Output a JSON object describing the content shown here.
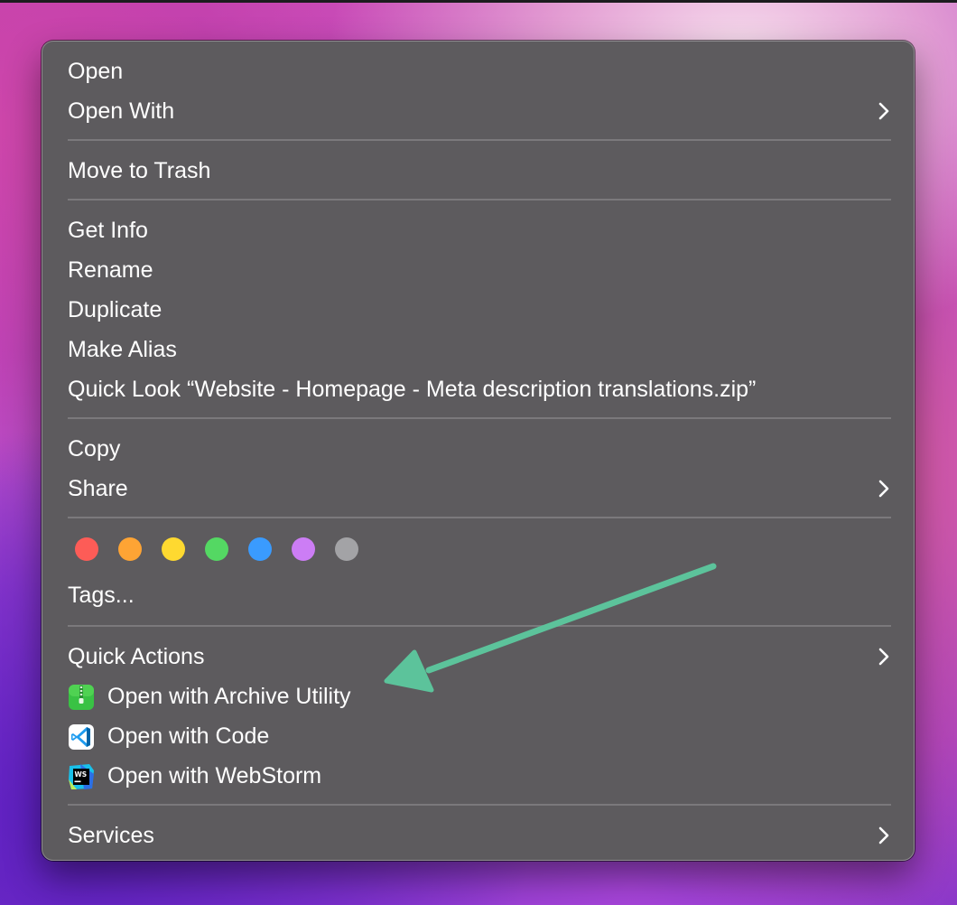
{
  "context_menu": {
    "open": "Open",
    "open_with": "Open With",
    "move_to_trash": "Move to Trash",
    "get_info": "Get Info",
    "rename": "Rename",
    "duplicate": "Duplicate",
    "make_alias": "Make Alias",
    "quick_look": "Quick Look “Website - Homepage - Meta description translations.zip”",
    "copy": "Copy",
    "share": "Share",
    "tags": "Tags...",
    "quick_actions": "Quick Actions",
    "open_archive_utility": "Open with Archive Utility",
    "open_code": "Open with Code",
    "open_webstorm": "Open with WebStorm",
    "services": "Services"
  },
  "tag_colors": [
    {
      "name": "red",
      "color": "#fd5c57"
    },
    {
      "name": "orange",
      "color": "#fea434"
    },
    {
      "name": "yellow",
      "color": "#fed930"
    },
    {
      "name": "green",
      "color": "#54d863"
    },
    {
      "name": "blue",
      "color": "#3a9bfe"
    },
    {
      "name": "purple",
      "color": "#cc7df5"
    },
    {
      "name": "gray",
      "color": "#a3a3a6"
    }
  ],
  "icons": {
    "archive_utility": "archive-utility-icon",
    "vscode": "vscode-icon",
    "webstorm": "webstorm-icon",
    "webstorm_badge": "WS"
  },
  "annotation": {
    "arrow_color": "#5cc39b"
  }
}
